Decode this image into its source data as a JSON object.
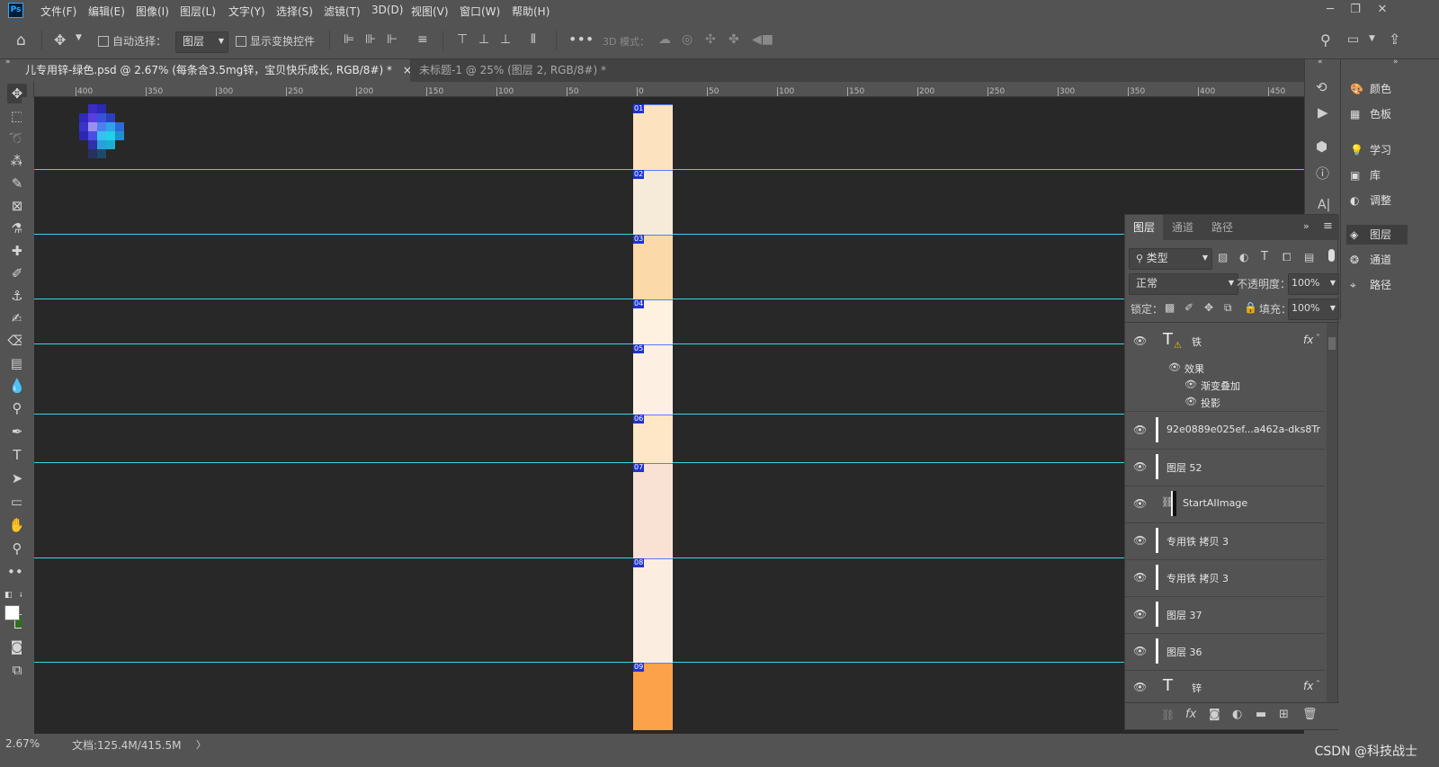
{
  "app": {
    "logo": "Ps"
  },
  "menu": [
    "文件(F)",
    "编辑(E)",
    "图像(I)",
    "图层(L)",
    "文字(Y)",
    "选择(S)",
    "滤镜(T)",
    "3D(D)",
    "视图(V)",
    "窗口(W)",
    "帮助(H)"
  ],
  "options": {
    "auto_select_label": "自动选择：",
    "auto_select_target": "图层",
    "show_transform_label": "显示变换控件",
    "mode_3d_label": "3D 模式："
  },
  "tabs": [
    {
      "title": "儿专用锌-绿色.psd @ 2.67% (每条含3.5mg锌，宝贝快乐成长, RGB/8#) *",
      "close": "×"
    },
    {
      "title": "未标题-1 @ 25% (图层 2, RGB/8#) *",
      "close": "×"
    }
  ],
  "ruler_labels": [
    "400",
    "350",
    "300",
    "250",
    "200",
    "150",
    "100",
    "50",
    "0",
    "50",
    "100",
    "150",
    "200",
    "250",
    "300",
    "350",
    "400",
    "450"
  ],
  "slices": [
    "01",
    "02",
    "03",
    "04",
    "05",
    "06",
    "07",
    "08",
    "09"
  ],
  "status": {
    "zoom": "2.67%",
    "doc": "文档:125.4M/415.5M",
    "arrow": "〉"
  },
  "mid_panel_icons": [
    "history-icon",
    "play-icon",
    "3d-icon",
    "info-icon",
    "text-icon"
  ],
  "right_panel": {
    "items": [
      {
        "icon": "color-icon",
        "label": "颜色"
      },
      {
        "icon": "swatches-icon",
        "label": "色板"
      },
      {
        "icon": "learn-icon",
        "label": "学习"
      },
      {
        "icon": "library-icon",
        "label": "库"
      },
      {
        "icon": "adjust-icon",
        "label": "调整"
      },
      {
        "icon": "layers-icon",
        "label": "图层"
      },
      {
        "icon": "channels-icon",
        "label": "通道"
      },
      {
        "icon": "paths-icon",
        "label": "路径"
      }
    ]
  },
  "layers_panel": {
    "tabs": [
      "图层",
      "通道",
      "路径"
    ],
    "filter_label": "类型",
    "blend_mode": "正常",
    "opacity_label": "不透明度：",
    "opacity_value": "100%",
    "lock_label": "锁定：",
    "fill_label": "填充：",
    "fill_value": "100%",
    "layers": [
      {
        "name": "铁",
        "type": "text",
        "fx": "fx"
      },
      {
        "name": "效果",
        "type": "effect-group"
      },
      {
        "name": "渐变叠加",
        "type": "effect"
      },
      {
        "name": "投影",
        "type": "effect"
      },
      {
        "name": "92e0889e025ef...a462a-dks8Tr",
        "type": "image"
      },
      {
        "name": "图层 52",
        "type": "image"
      },
      {
        "name": "StartAIImage",
        "type": "image"
      },
      {
        "name": "专用铁 拷贝 3",
        "type": "image"
      },
      {
        "name": "专用铁 拷贝 3",
        "type": "image"
      },
      {
        "name": "图层 37",
        "type": "image"
      },
      {
        "name": "图层 36",
        "type": "image"
      },
      {
        "name": "锌",
        "type": "text",
        "fx": "fx"
      }
    ]
  },
  "watermark": "CSDN @科技战士"
}
